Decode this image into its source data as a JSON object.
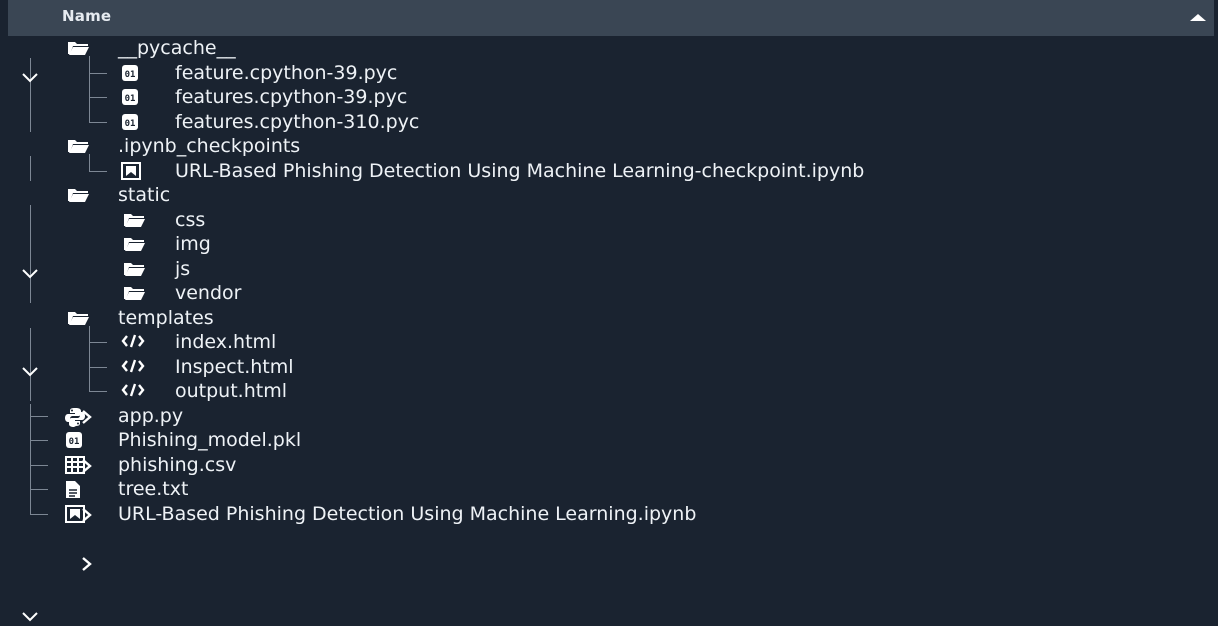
{
  "header": {
    "name_label": "Name",
    "sort_icon": "caret-up-icon"
  },
  "tree": [
    {
      "label": "__pycache__",
      "type": "folder",
      "depth": 0,
      "expanded": true
    },
    {
      "label": "feature.cpython-39.pyc",
      "type": "binary",
      "depth": 1
    },
    {
      "label": "features.cpython-39.pyc",
      "type": "binary",
      "depth": 1
    },
    {
      "label": "features.cpython-310.pyc",
      "type": "binary",
      "depth": 1
    },
    {
      "label": ".ipynb_checkpoints",
      "type": "folder",
      "depth": 0,
      "expanded": true
    },
    {
      "label": "URL-Based Phishing Detection Using Machine Learning-checkpoint.ipynb",
      "type": "notebook",
      "depth": 1
    },
    {
      "label": "static",
      "type": "folder",
      "depth": 0,
      "expanded": true
    },
    {
      "label": "css",
      "type": "folder",
      "depth": 1,
      "expanded": false
    },
    {
      "label": "img",
      "type": "folder",
      "depth": 1,
      "expanded": false
    },
    {
      "label": "js",
      "type": "folder",
      "depth": 1,
      "expanded": false
    },
    {
      "label": "vendor",
      "type": "folder",
      "depth": 1,
      "expanded": false
    },
    {
      "label": "templates",
      "type": "folder",
      "depth": 0,
      "expanded": true
    },
    {
      "label": "index.html",
      "type": "html",
      "depth": 1
    },
    {
      "label": "Inspect.html",
      "type": "html",
      "depth": 1
    },
    {
      "label": "output.html",
      "type": "html",
      "depth": 1
    },
    {
      "label": "app.py",
      "type": "python",
      "depth": 0
    },
    {
      "label": "Phishing_model.pkl",
      "type": "binary",
      "depth": 0
    },
    {
      "label": "phishing.csv",
      "type": "csv",
      "depth": 0
    },
    {
      "label": "tree.txt",
      "type": "text",
      "depth": 0
    },
    {
      "label": "URL-Based Phishing Detection Using Machine Learning.ipynb",
      "type": "notebook",
      "depth": 0
    }
  ],
  "icon_map": {
    "folder": "folder-icon",
    "binary": "binary-file-icon",
    "notebook": "notebook-icon",
    "html": "html-file-icon",
    "python": "python-file-icon",
    "csv": "table-file-icon",
    "text": "text-file-icon"
  }
}
